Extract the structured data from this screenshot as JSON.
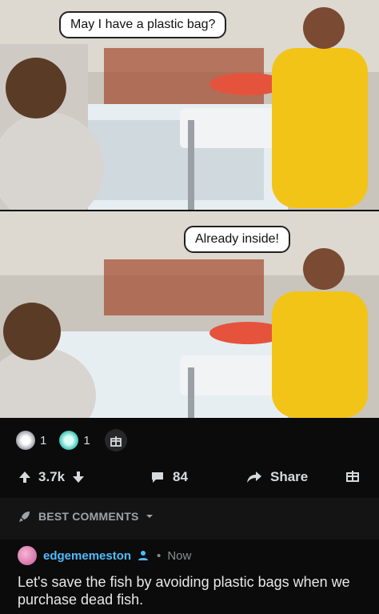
{
  "meme": {
    "panel1_caption": "May I have a plastic bag?",
    "panel2_caption": "Already inside!"
  },
  "awards": [
    {
      "icon": "clapping-hands-award-icon",
      "count": "1"
    },
    {
      "icon": "angel-award-icon",
      "count": "1"
    }
  ],
  "actions": {
    "score": "3.7k",
    "comments_count": "84",
    "share_label": "Share"
  },
  "sort": {
    "label": "BEST COMMENTS"
  },
  "comment": {
    "username": "edgememeston",
    "time": "Now",
    "separator": "•",
    "body": "Let's save the fish by avoiding plastic bags when we purchase dead fish."
  },
  "colors": {
    "background": "#0b0b0b",
    "username": "#4fbcff",
    "text": "#d7dadc"
  }
}
